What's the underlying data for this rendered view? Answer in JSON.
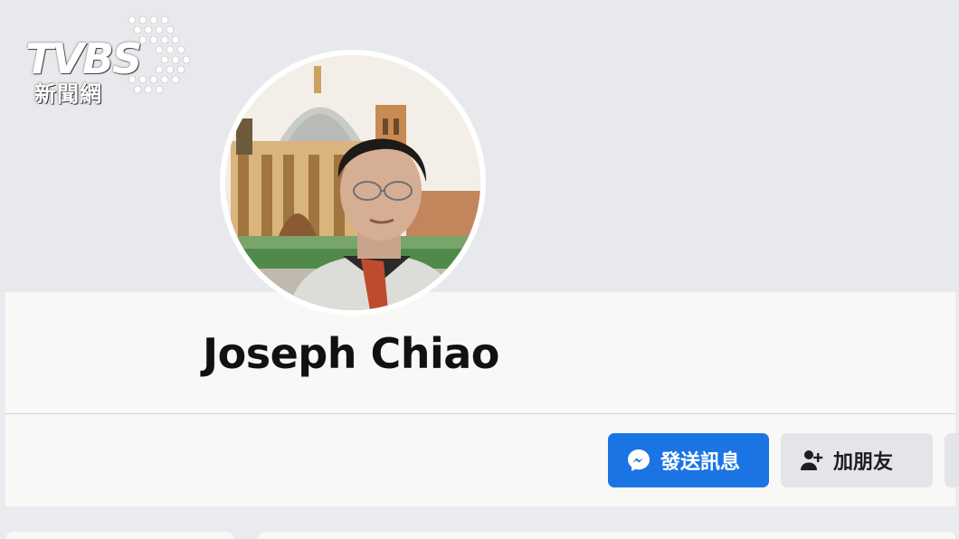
{
  "watermark": {
    "logo": "TVBS",
    "subtitle": "新聞網"
  },
  "profile": {
    "name": "Joseph Chiao"
  },
  "actions": {
    "message_label": "發送訊息",
    "add_friend_label": "加朋友"
  },
  "colors": {
    "primary": "#1b74e4",
    "secondary_button": "#e4e5e8",
    "page_bg": "#e9ebee",
    "card_bg": "#f8f8f7"
  },
  "icons": {
    "message": "messenger-icon",
    "add_friend": "add-friend-icon"
  }
}
